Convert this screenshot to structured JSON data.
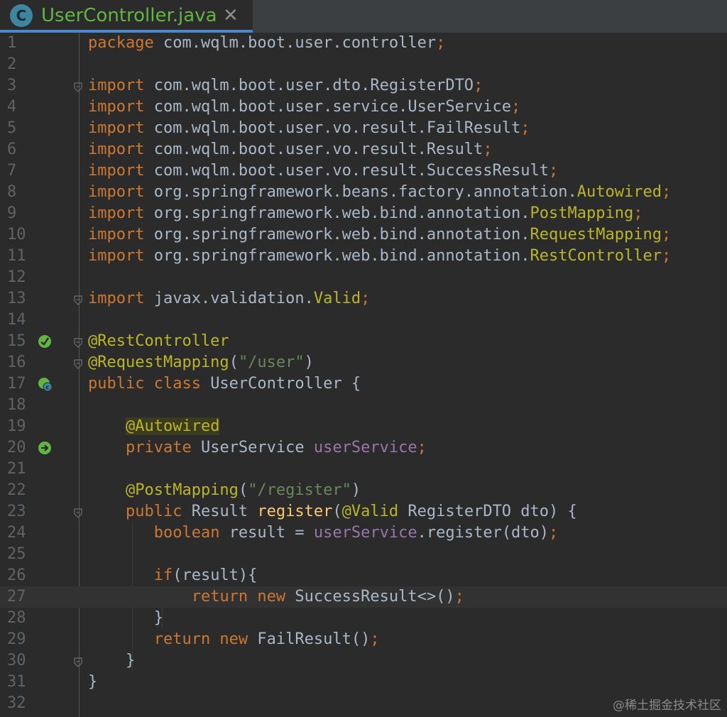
{
  "tab": {
    "icon_letter": "C",
    "title": "UserController.java",
    "close": "✕"
  },
  "lines": [
    {
      "n": "1",
      "tokens": [
        [
          "kw",
          "package"
        ],
        [
          "",
          "com.wqlm.boot.user.controller"
        ],
        [
          "kw",
          ";"
        ]
      ]
    },
    {
      "n": "2",
      "tokens": []
    },
    {
      "n": "3",
      "fold": true,
      "tokens": [
        [
          "kw",
          "import"
        ],
        [
          "",
          "com.wqlm.boot.user.dto.RegisterDTO"
        ],
        [
          "kw",
          ";"
        ]
      ]
    },
    {
      "n": "4",
      "tokens": [
        [
          "kw",
          "import"
        ],
        [
          "",
          "com.wqlm.boot.user.service.UserService"
        ],
        [
          "kw",
          ";"
        ]
      ]
    },
    {
      "n": "5",
      "tokens": [
        [
          "kw",
          "import"
        ],
        [
          "",
          "com.wqlm.boot.user.vo.result.FailResult"
        ],
        [
          "kw",
          ";"
        ]
      ]
    },
    {
      "n": "6",
      "tokens": [
        [
          "kw",
          "import"
        ],
        [
          "",
          "com.wqlm.boot.user.vo.result.Result"
        ],
        [
          "kw",
          ";"
        ]
      ]
    },
    {
      "n": "7",
      "tokens": [
        [
          "kw",
          "import"
        ],
        [
          "",
          "com.wqlm.boot.user.vo.result.SuccessResult"
        ],
        [
          "kw",
          ";"
        ]
      ]
    },
    {
      "n": "8",
      "tokens": [
        [
          "kw",
          "import"
        ],
        [
          "",
          "org.springframework.beans.factory.annotation."
        ],
        [
          "an",
          "Autowired"
        ],
        [
          "kw",
          ";"
        ]
      ]
    },
    {
      "n": "9",
      "tokens": [
        [
          "kw",
          "import"
        ],
        [
          "",
          "org.springframework.web.bind.annotation."
        ],
        [
          "an",
          "PostMapping"
        ],
        [
          "kw",
          ";"
        ]
      ]
    },
    {
      "n": "10",
      "tokens": [
        [
          "kw",
          "import"
        ],
        [
          "",
          "org.springframework.web.bind.annotation."
        ],
        [
          "an",
          "RequestMapping"
        ],
        [
          "kw",
          ";"
        ]
      ]
    },
    {
      "n": "11",
      "tokens": [
        [
          "kw",
          "import"
        ],
        [
          "",
          "org.springframework.web.bind.annotation."
        ],
        [
          "an",
          "RestController"
        ],
        [
          "kw",
          ";"
        ]
      ]
    },
    {
      "n": "12",
      "tokens": []
    },
    {
      "n": "13",
      "fold": true,
      "tokens": [
        [
          "kw",
          "import"
        ],
        [
          "",
          "javax.validation."
        ],
        [
          "an",
          "Valid"
        ],
        [
          "kw",
          ";"
        ]
      ]
    },
    {
      "n": "14",
      "tokens": []
    },
    {
      "n": "15",
      "fold": true,
      "gutter": "bean-icon",
      "tokens": [
        [
          "an",
          "@RestController"
        ]
      ]
    },
    {
      "n": "16",
      "fold": true,
      "tokens": [
        [
          "an",
          "@RequestMapping"
        ],
        [
          "",
          "("
        ],
        [
          "str",
          "\"/user\""
        ],
        [
          "",
          ")"
        ]
      ]
    },
    {
      "n": "17",
      "gutter": "class-bean-icon",
      "tokens": [
        [
          "kw",
          "public class "
        ],
        [
          "",
          "UserController {"
        ]
      ]
    },
    {
      "n": "18",
      "tokens": []
    },
    {
      "n": "19",
      "tokens": [
        [
          "",
          "    "
        ],
        [
          "an hl",
          "@Autowired"
        ]
      ]
    },
    {
      "n": "20",
      "gutter": "autowired-icon",
      "tokens": [
        [
          "",
          "    "
        ],
        [
          "kw",
          "private "
        ],
        [
          "",
          "UserService "
        ],
        [
          "fld",
          "userService"
        ],
        [
          "kw",
          ";"
        ]
      ]
    },
    {
      "n": "21",
      "tokens": []
    },
    {
      "n": "22",
      "tokens": [
        [
          "",
          "    "
        ],
        [
          "an",
          "@PostMapping"
        ],
        [
          "",
          "("
        ],
        [
          "str",
          "\"/register\""
        ],
        [
          "",
          ")"
        ]
      ]
    },
    {
      "n": "23",
      "fold": true,
      "tokens": [
        [
          "",
          "    "
        ],
        [
          "kw",
          "public "
        ],
        [
          "",
          "Result "
        ],
        [
          "fn",
          "register"
        ],
        [
          "",
          "("
        ],
        [
          "an",
          "@Valid "
        ],
        [
          "",
          "RegisterDTO dto) {"
        ]
      ]
    },
    {
      "n": "24",
      "tokens": [
        [
          "",
          "       "
        ],
        [
          "kw",
          "boolean "
        ],
        [
          "",
          "result = "
        ],
        [
          "fld",
          "userService"
        ],
        [
          "",
          ".register(dto)"
        ],
        [
          "kw",
          ";"
        ]
      ]
    },
    {
      "n": "25",
      "tokens": []
    },
    {
      "n": "26",
      "tokens": [
        [
          "",
          "       "
        ],
        [
          "kw",
          "if"
        ],
        [
          "",
          "(result){"
        ]
      ]
    },
    {
      "n": "27",
      "current": true,
      "tokens": [
        [
          "",
          "           "
        ],
        [
          "kw",
          "return new "
        ],
        [
          "",
          "SuccessResult<>()"
        ],
        [
          "kw",
          ";"
        ]
      ]
    },
    {
      "n": "28",
      "tokens": [
        [
          "",
          "       }"
        ]
      ]
    },
    {
      "n": "29",
      "tokens": [
        [
          "",
          "       "
        ],
        [
          "kw",
          "return new "
        ],
        [
          "",
          "FailResult()"
        ],
        [
          "kw",
          ";"
        ]
      ]
    },
    {
      "n": "30",
      "fold": true,
      "tokens": [
        [
          "",
          "    }"
        ]
      ]
    },
    {
      "n": "31",
      "tokens": [
        [
          "",
          "}"
        ]
      ]
    },
    {
      "n": "32",
      "tokens": []
    }
  ],
  "watermark": "@稀土掘金技术社区",
  "colors": {
    "keyword": "#cc7832",
    "annotation": "#bbb529",
    "string": "#6a8759",
    "field": "#9876aa",
    "method": "#ffc66d",
    "text": "#a9b7c6",
    "tab_title": "#62b543"
  }
}
